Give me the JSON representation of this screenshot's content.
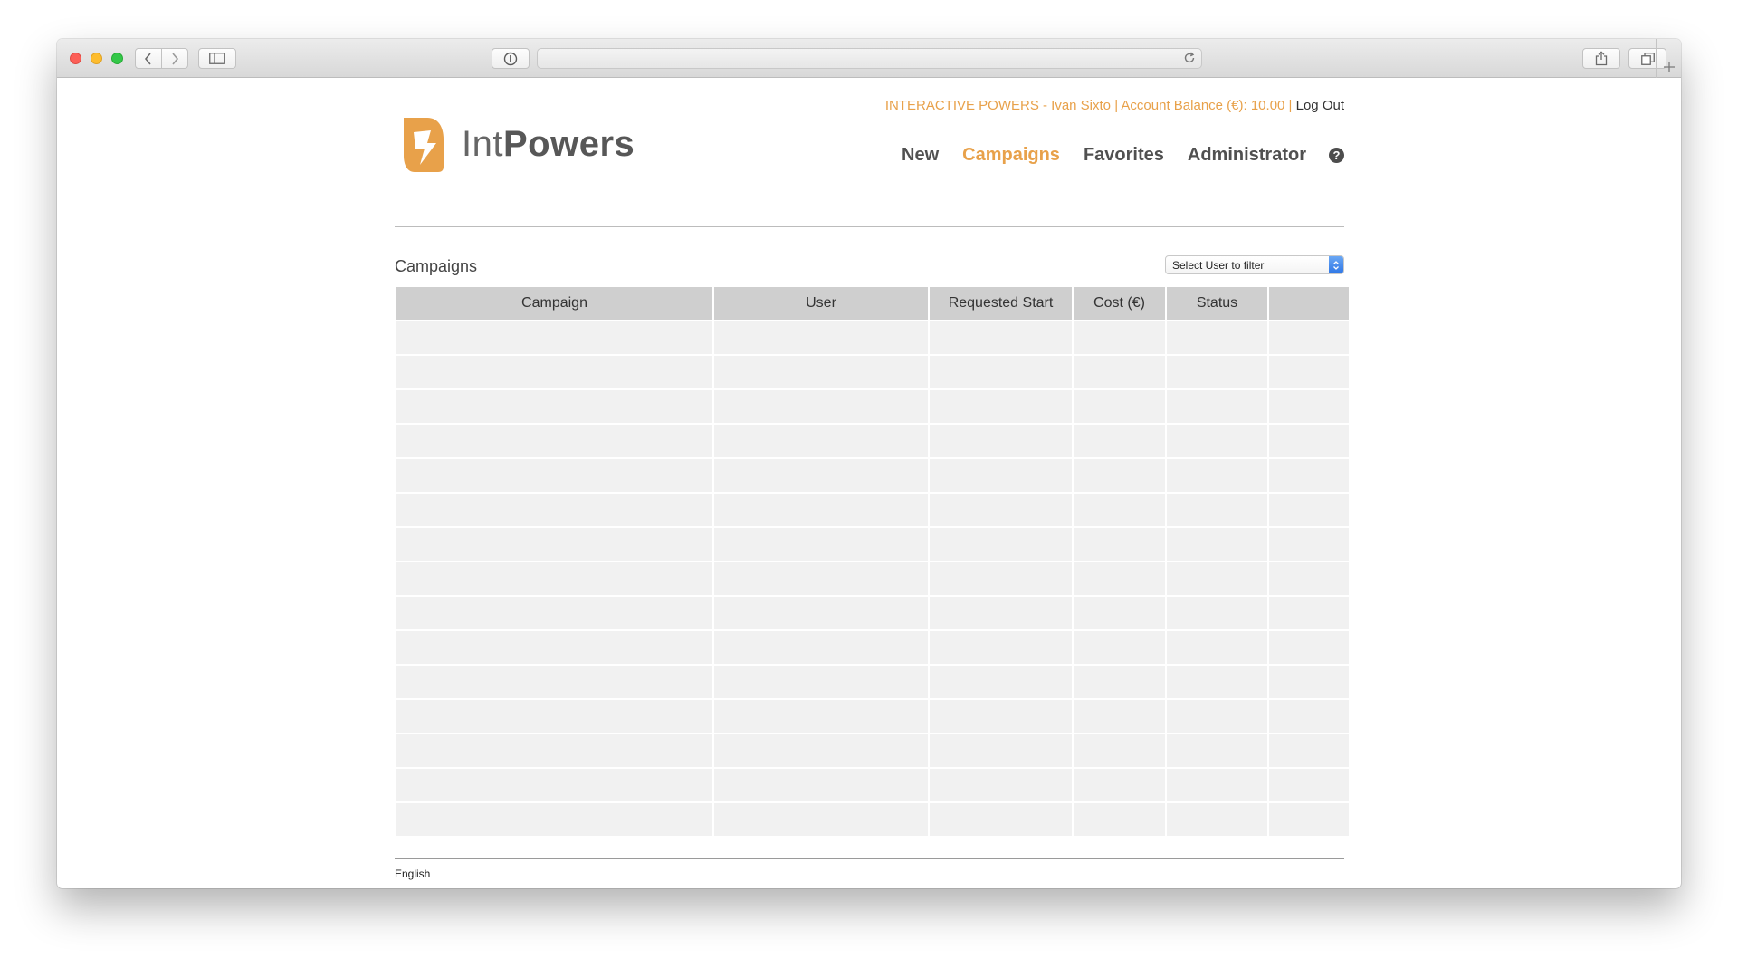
{
  "browser": {
    "icons": {
      "back": "chevron-left-icon",
      "forward": "chevron-right-icon",
      "sidebar": "sidebar-icon",
      "info": "info-icon",
      "reload": "reload-icon",
      "share": "share-icon",
      "tabs": "tabs-icon",
      "new_tab": "plus-icon"
    }
  },
  "header": {
    "brand_light": "Int",
    "brand_bold": "Powers",
    "account_info": "INTERACTIVE POWERS - Ivan Sixto | Account Balance (€): 10.00 |",
    "logout_label": "Log Out",
    "nav": {
      "new": "New",
      "campaigns": "Campaigns",
      "favorites": "Favorites",
      "administrator": "Administrator"
    },
    "help_glyph": "?",
    "active_color": "#e8a14a"
  },
  "main": {
    "section_title": "Campaigns",
    "user_filter": {
      "selected": "Select User to filter"
    },
    "table": {
      "columns": [
        "Campaign",
        "User",
        "Requested Start",
        "Cost (€)",
        "Status",
        ""
      ],
      "rows": [
        [
          "",
          "",
          "",
          "",
          "",
          ""
        ],
        [
          "",
          "",
          "",
          "",
          "",
          ""
        ],
        [
          "",
          "",
          "",
          "",
          "",
          ""
        ],
        [
          "",
          "",
          "",
          "",
          "",
          ""
        ],
        [
          "",
          "",
          "",
          "",
          "",
          ""
        ],
        [
          "",
          "",
          "",
          "",
          "",
          ""
        ],
        [
          "",
          "",
          "",
          "",
          "",
          ""
        ],
        [
          "",
          "",
          "",
          "",
          "",
          ""
        ],
        [
          "",
          "",
          "",
          "",
          "",
          ""
        ],
        [
          "",
          "",
          "",
          "",
          "",
          ""
        ],
        [
          "",
          "",
          "",
          "",
          "",
          ""
        ],
        [
          "",
          "",
          "",
          "",
          "",
          ""
        ],
        [
          "",
          "",
          "",
          "",
          "",
          ""
        ],
        [
          "",
          "",
          "",
          "",
          "",
          ""
        ],
        [
          "",
          "",
          "",
          "",
          "",
          ""
        ]
      ]
    }
  },
  "footer": {
    "language": "English"
  }
}
